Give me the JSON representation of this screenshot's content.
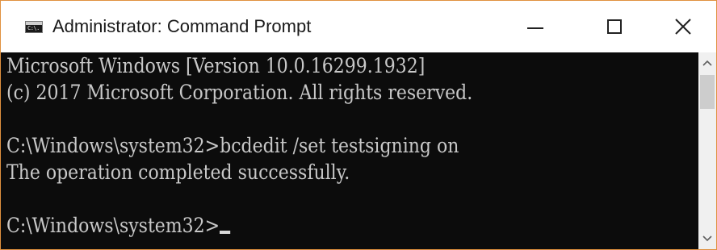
{
  "window": {
    "title": "Administrator: Command Prompt",
    "app_icon_text": "C:\\."
  },
  "console": {
    "lines": [
      "Microsoft Windows [Version 10.0.16299.1932]",
      "(c) 2017 Microsoft Corporation. All rights reserved.",
      "",
      "C:\\Windows\\system32>bcdedit /set testsigning on",
      "The operation completed successfully.",
      "",
      "C:\\Windows\\system32>"
    ]
  },
  "icons": {
    "app": "command-prompt-icon",
    "minimize": "minimize-icon",
    "maximize": "maximize-icon",
    "close": "close-icon",
    "scroll_up": "chevron-up-icon",
    "scroll_down": "chevron-down-icon"
  },
  "colors": {
    "console_background": "#0c0c0c",
    "console_text": "#c8c8c8",
    "window_border": "#e0913f",
    "titlebar": "#ffffff"
  }
}
